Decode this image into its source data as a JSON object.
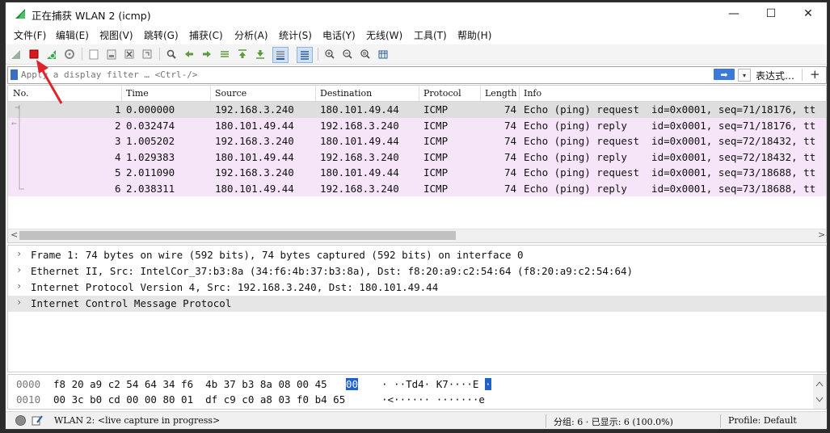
{
  "window": {
    "title": "正在捕获 WLAN 2 (icmp)",
    "controls": {
      "minimize": "—",
      "maximize": "☐",
      "close": "✕"
    }
  },
  "menu": [
    "文件(F)",
    "编辑(E)",
    "视图(V)",
    "跳转(G)",
    "捕获(C)",
    "分析(A)",
    "统计(S)",
    "电话(Y)",
    "无线(W)",
    "工具(T)",
    "帮助(H)"
  ],
  "toolbar": {
    "icons": [
      "shark-fin-start-icon",
      "stop-capture-icon",
      "restart-capture-icon",
      "capture-options-icon",
      "open-file-icon",
      "save-file-icon",
      "close-file-icon",
      "reload-icon",
      "find-packet-icon",
      "go-back-icon",
      "go-forward-icon",
      "go-to-packet-icon",
      "go-first-icon",
      "go-last-icon",
      "auto-scroll-icon",
      "colorize-icon",
      "zoom-in-icon",
      "zoom-out-icon",
      "zoom-normal-icon",
      "resize-columns-icon"
    ],
    "stop_color": "#d61c1c"
  },
  "filter": {
    "placeholder": "Apply a display filter … <Ctrl-/>",
    "expression_label": "表达式…",
    "plus": "+",
    "apply": "➡",
    "dropdown": "▾"
  },
  "packet_list": {
    "columns": [
      "No.",
      "Time",
      "Source",
      "Destination",
      "Protocol",
      "Length",
      "Info"
    ],
    "rows": [
      {
        "no": "1",
        "time": "0.000000",
        "src": "192.168.3.240",
        "dst": "180.101.49.44",
        "proto": "ICMP",
        "len": "74",
        "info": "Echo (ping) request  id=0x0001, seq=71/18176, tt"
      },
      {
        "no": "2",
        "time": "0.032474",
        "src": "180.101.49.44",
        "dst": "192.168.3.240",
        "proto": "ICMP",
        "len": "74",
        "info": "Echo (ping) reply    id=0x0001, seq=71/18176, tt"
      },
      {
        "no": "3",
        "time": "1.005202",
        "src": "192.168.3.240",
        "dst": "180.101.49.44",
        "proto": "ICMP",
        "len": "74",
        "info": "Echo (ping) request  id=0x0001, seq=72/18432, tt"
      },
      {
        "no": "4",
        "time": "1.029383",
        "src": "180.101.49.44",
        "dst": "192.168.3.240",
        "proto": "ICMP",
        "len": "74",
        "info": "Echo (ping) reply    id=0x0001, seq=72/18432, tt"
      },
      {
        "no": "5",
        "time": "2.011090",
        "src": "192.168.3.240",
        "dst": "180.101.49.44",
        "proto": "ICMP",
        "len": "74",
        "info": "Echo (ping) request  id=0x0001, seq=73/18688, tt"
      },
      {
        "no": "6",
        "time": "2.038311",
        "src": "180.101.49.44",
        "dst": "192.168.3.240",
        "proto": "ICMP",
        "len": "74",
        "info": "Echo (ping) reply    id=0x0001, seq=73/18688, tt"
      }
    ],
    "scroll_left": "<",
    "scroll_right": ">"
  },
  "details": [
    "Frame 1: 74 bytes on wire (592 bits), 74 bytes captured (592 bits) on interface 0",
    "Ethernet II, Src: IntelCor_37:b3:8a (34:f6:4b:37:b3:8a), Dst: f8:20:a9:c2:54:64 (f8:20:a9:c2:54:64)",
    "Internet Protocol Version 4, Src: 192.168.3.240, Dst: 180.101.49.44",
    "Internet Control Message Protocol"
  ],
  "bytes": [
    {
      "offset": "0000",
      "hex": "f8 20 a9 c2 54 64 34 f6  4b 37 b3 8a 08 00 45",
      "hex_hl": "00",
      "ascii": "· ··Td4· K7····E",
      "ascii_hl": "·"
    },
    {
      "offset": "0010",
      "hex": "00 3c b0 cd 00 00 80 01  df c9 c0 a8 03 f0 b4 65",
      "hex_hl": "",
      "ascii": "·<······ ·······e",
      "ascii_hl": ""
    }
  ],
  "status": {
    "capture": "WLAN 2: <live capture in progress>",
    "packets": "分组: 6 · 已显示: 6 (100.0%)",
    "profile": "Profile: Default"
  },
  "annotation_color": "#e0242c"
}
